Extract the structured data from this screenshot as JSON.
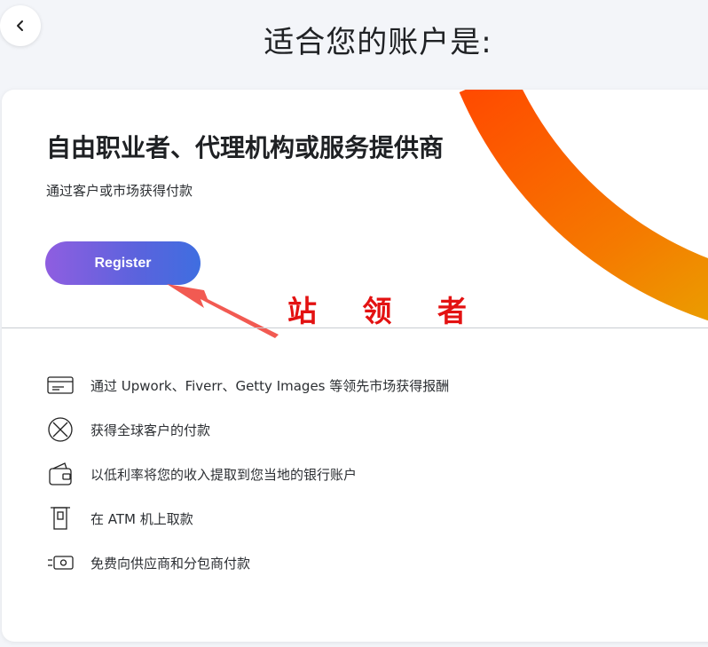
{
  "header": {
    "title": "适合您的账户是:"
  },
  "card": {
    "title": "自由职业者、代理机构或服务提供商",
    "subtitle": "通过客户或市场获得付款",
    "register_label": "Register",
    "overlay_text": "站 领 者"
  },
  "features": [
    {
      "icon": "card-icon",
      "label": "通过 Upwork、Fiverr、Getty Images 等领先市场获得报酬"
    },
    {
      "icon": "globe-icon",
      "label": "获得全球客户的付款"
    },
    {
      "icon": "wallet-icon",
      "label": "以低利率将您的收入提取到您当地的银行账户"
    },
    {
      "icon": "atm-icon",
      "label": "在 ATM 机上取款"
    },
    {
      "icon": "cash-icon",
      "label": "免费向供应商和分包商付款"
    }
  ],
  "colors": {
    "accent_orange": "#ff5a00",
    "accent_gold": "#e8aa00",
    "button_gradient_start": "#8f5ee0",
    "button_gradient_end": "#3f6ee0",
    "overlay_red": "#e31212"
  }
}
